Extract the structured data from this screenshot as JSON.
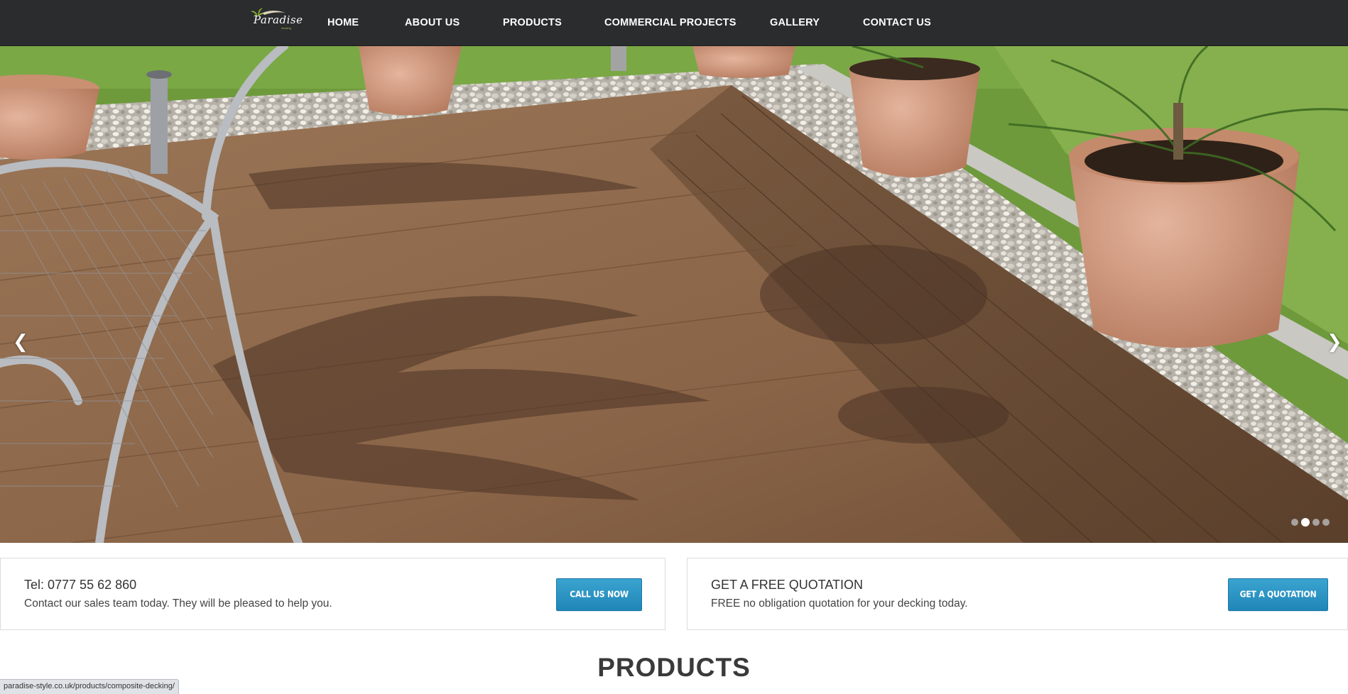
{
  "header": {
    "logo_text": "Paradise",
    "logo_sub": "decking",
    "nav": [
      {
        "label": "HOME"
      },
      {
        "label": "ABOUT US"
      },
      {
        "label": "PRODUCTS"
      },
      {
        "label": "COMMERCIAL PROJECTS"
      },
      {
        "label": "GALLERY"
      },
      {
        "label": "CONTACT US"
      }
    ]
  },
  "slider": {
    "prev_icon": "chevron-left-icon",
    "next_icon": "chevron-right-icon",
    "slide_count": 4,
    "active_slide": 2
  },
  "cta": [
    {
      "title": "Tel: 0777 55 62 860",
      "description": "Contact our sales team today. They will be pleased to help you.",
      "button": "CALL US NOW"
    },
    {
      "title": "GET A FREE QUOTATION",
      "description": "FREE no obligation quotation for your decking today.",
      "button": "GET A QUOTATION"
    }
  ],
  "section": {
    "title": "PRODUCTS"
  },
  "status_bar": {
    "url": "paradise-style.co.uk/products/composite-decking/"
  },
  "colors": {
    "header_bg": "#2b2c2e",
    "button_blue": "#2a93c4",
    "logo_green": "#9bc23c"
  }
}
